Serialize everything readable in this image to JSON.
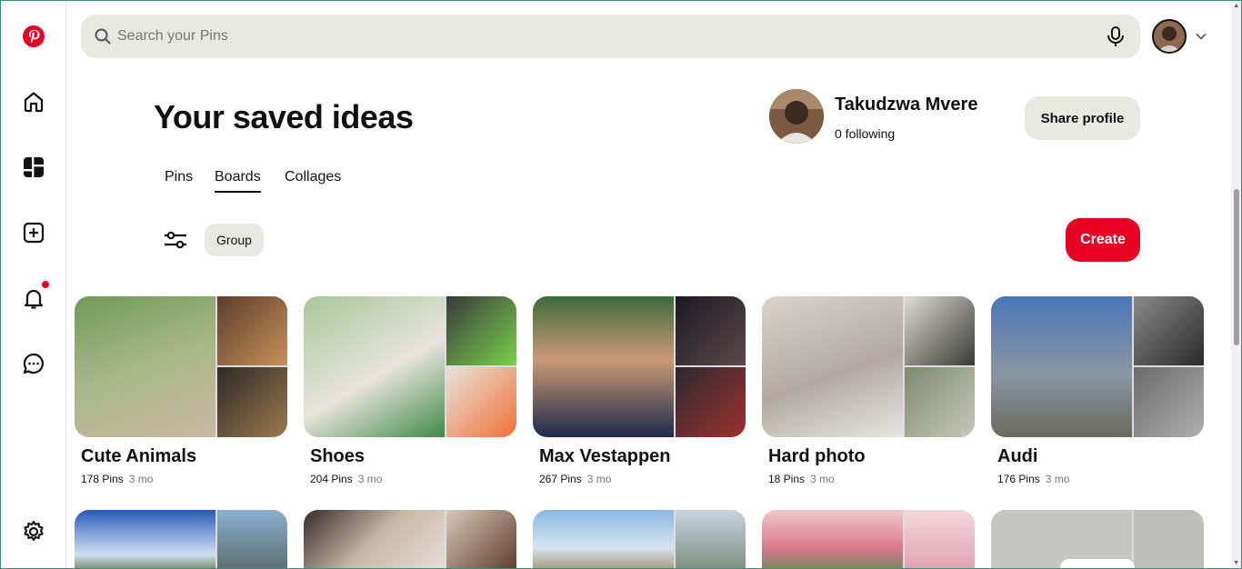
{
  "search": {
    "placeholder": "Search your Pins"
  },
  "header": {
    "title": "Your saved ideas",
    "profile_name": "Takudzwa Mvere",
    "following": "0 following",
    "share_label": "Share profile"
  },
  "tabs": [
    {
      "label": "Pins",
      "active": false
    },
    {
      "label": "Boards",
      "active": true
    },
    {
      "label": "Collages",
      "active": false
    }
  ],
  "filters": {
    "group_label": "Group",
    "create_label": "Create"
  },
  "boards": [
    {
      "name": "Cute Animals",
      "pins": "178 Pins",
      "ago": "3 mo",
      "colors": [
        "#8aa86a",
        "#b8875a",
        "#4a3c30"
      ]
    },
    {
      "name": "Shoes",
      "pins": "204 Pins",
      "ago": "3 mo",
      "colors": [
        "#9cbf8d",
        "#54a84a",
        "#e8703a"
      ]
    },
    {
      "name": "Max Vestappen",
      "pins": "267 Pins",
      "ago": "3 mo",
      "colors": [
        "#2c3a5a",
        "#3a2a2a",
        "#2a2a36"
      ]
    },
    {
      "name": "Hard photo",
      "pins": "18 Pins",
      "ago": "3 mo",
      "colors": [
        "#c9c6c0",
        "#7a7a6a",
        "#9a9a88"
      ]
    },
    {
      "name": "Audi",
      "pins": "176 Pins",
      "ago": "3 mo",
      "colors": [
        "#7a8a9a",
        "#3a3a3a",
        "#8a8a8a"
      ]
    }
  ],
  "boards_row2": [
    {
      "colors": [
        "#3a6ab8",
        "#5a6a6a"
      ]
    },
    {
      "colors": [
        "#8a6a5a",
        "#b0a090"
      ]
    },
    {
      "colors": [
        "#8ab0d8",
        "#a0a8b0"
      ]
    },
    {
      "colors": [
        "#e0909a",
        "#e8b0b8"
      ]
    },
    {
      "colors": [
        "#c8c8c4",
        "#bcbcb8"
      ]
    }
  ],
  "nav": [
    "pinterest-logo",
    "home-icon",
    "boards-icon",
    "create-icon",
    "notifications-icon",
    "messages-icon",
    "settings-icon"
  ]
}
